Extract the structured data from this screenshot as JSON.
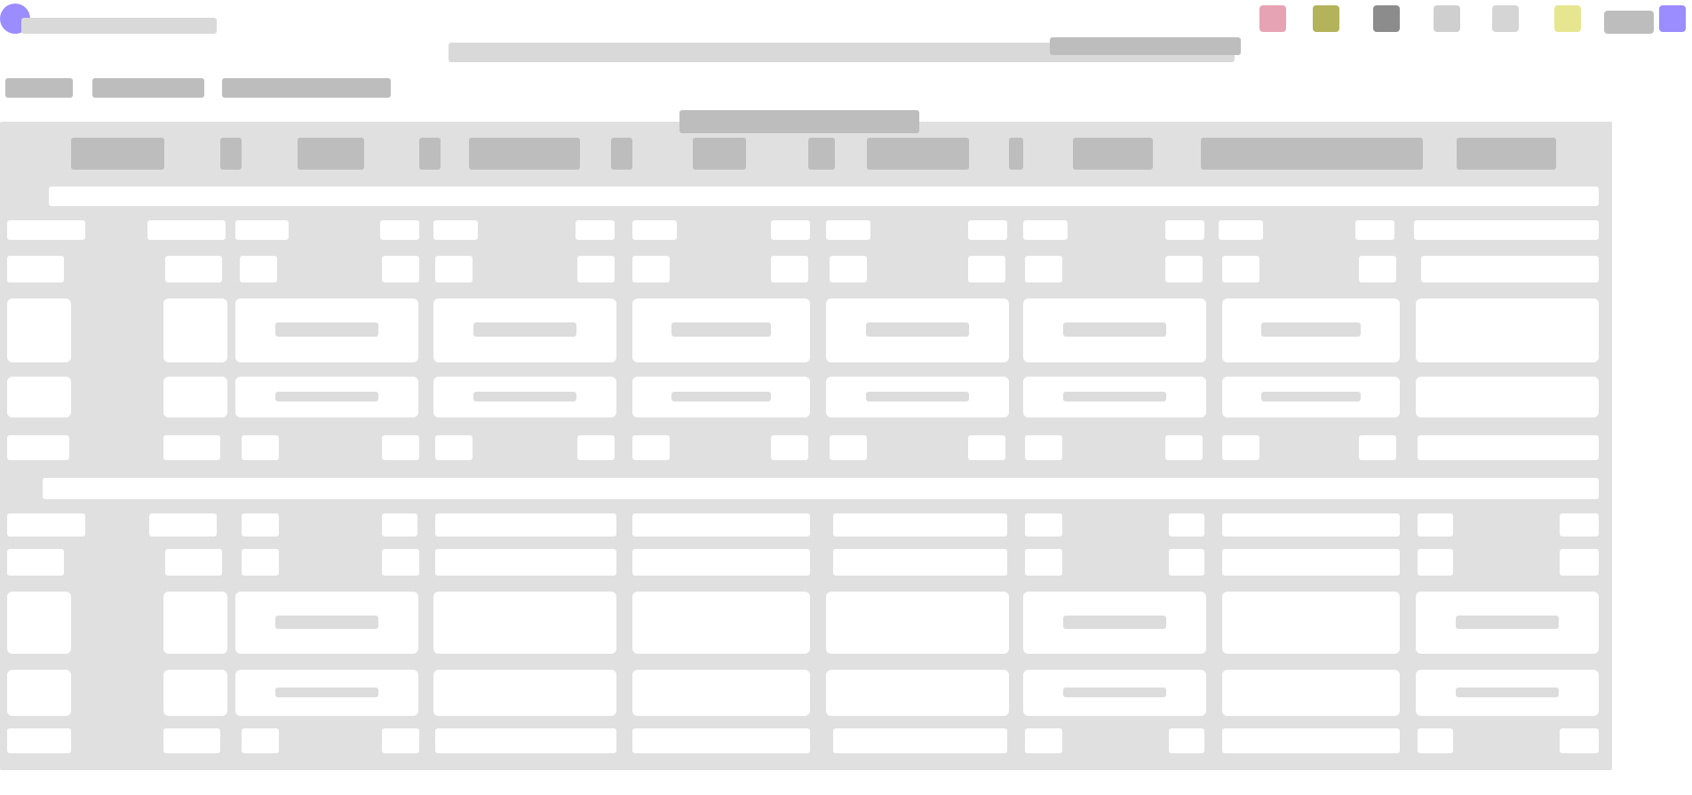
{
  "window": {
    "title": "",
    "tabs": [
      "",
      "",
      ""
    ]
  },
  "toolbar": {
    "icons": [
      "pink-square-icon",
      "olive-square-icon",
      "dark-square-icon",
      "light-square-icon",
      "gray-square-icon",
      "yellow-square-icon",
      "text-badge-icon",
      "purple-corner-icon"
    ],
    "colors": {
      "pink": "#e6a3b4",
      "olive": "#b2b35a",
      "dark": "#8c8c8c",
      "light": "#cfcfcf",
      "gray": "#d5d5d5",
      "yellow": "#e6e690",
      "purple": "#9b8cff"
    }
  },
  "search": {
    "placeholder": ""
  },
  "table": {
    "columns": [
      "",
      "",
      "",
      "",
      "",
      "",
      "",
      "",
      "",
      ""
    ],
    "rows": 10
  }
}
